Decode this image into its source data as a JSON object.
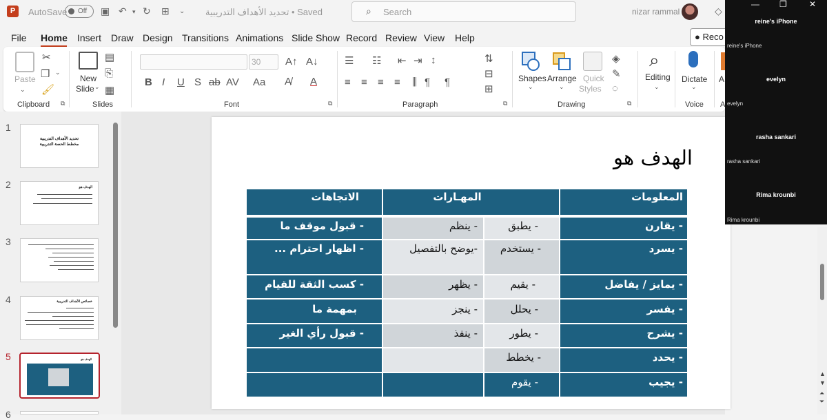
{
  "titlebar": {
    "app_icon": "P",
    "autosave_label": "AutoSave",
    "toggle_state": "Off",
    "doc_title": "تحديد الأهداف التدريبية • Saved",
    "search_placeholder": "Search",
    "user_name": "nizar rammal"
  },
  "menu": {
    "items": [
      "File",
      "Home",
      "Insert",
      "Draw",
      "Design",
      "Transitions",
      "Animations",
      "Slide Show",
      "Record",
      "Review",
      "View",
      "Help"
    ],
    "record_button": "Reco"
  },
  "ribbon": {
    "clipboard": {
      "paste": "Paste",
      "label": "Clipboard"
    },
    "slides": {
      "new_slide": "New",
      "new_slide_2": "Slide",
      "label": "Slides"
    },
    "font": {
      "size": "30",
      "label": "Font"
    },
    "paragraph": {
      "label": "Paragraph"
    },
    "drawing": {
      "shapes": "Shapes",
      "arrange": "Arrange",
      "quick_styles": "Quick",
      "quick_styles_2": "Styles",
      "label": "Drawing"
    },
    "editing": {
      "label": "Editing"
    },
    "voice": {
      "dictate": "Dictate",
      "label": "Voice"
    },
    "extra": {
      "label_a": "A",
      "label_a2": "A"
    }
  },
  "thumbnails": {
    "numbers": [
      "1",
      "2",
      "3",
      "4",
      "5",
      "6"
    ],
    "slide1_line1": "تحديد الأهداف التدريبية",
    "slide1_line2": "مخطط الحصة التدريبية",
    "slide2_title": "الهدف هو",
    "slide4_title": "خصائص الأهداف التدريبية",
    "slide5_title": "الهدف هو"
  },
  "slide": {
    "title": "الهدف هو",
    "table": {
      "headers": [
        "المعلومات",
        "المهـارات",
        "الاتجاهات"
      ],
      "rows": [
        [
          "- يقارن",
          "- يطبق",
          "- ينظم",
          "- قبول موقف ما"
        ],
        [
          "- يسرد",
          "- يستخدم",
          "-يوضح بالتفصيل",
          "- اظهار احترام ..."
        ],
        [
          "- يمايز / يفاضل",
          "- يقيم",
          "- يظهر",
          "- كسب الثقة للقيام"
        ],
        [
          "- يفسر",
          "- يحلل",
          "- ينجز",
          "بمهمة ما"
        ],
        [
          "- يشرح",
          "- يطور",
          "- ينفذ",
          "- قبول رأي الغير"
        ],
        [
          "- يحدد",
          "- يخطط",
          "",
          ""
        ],
        [
          "- يجيب",
          "- يقوم",
          "",
          ""
        ]
      ]
    }
  },
  "participants": [
    {
      "name": "reine's iPhone",
      "sub": "reine's iPhone"
    },
    {
      "name": "evelyn",
      "sub": "evelyn"
    },
    {
      "name": "rasha sankari",
      "sub": "rasha sankari"
    },
    {
      "name": "Rima krounbi",
      "sub": "Rima krounbi"
    }
  ],
  "colors": {
    "accent": "#c43e1c",
    "table_dark": "#1d6080",
    "selected_thumb": "#b5232d"
  }
}
